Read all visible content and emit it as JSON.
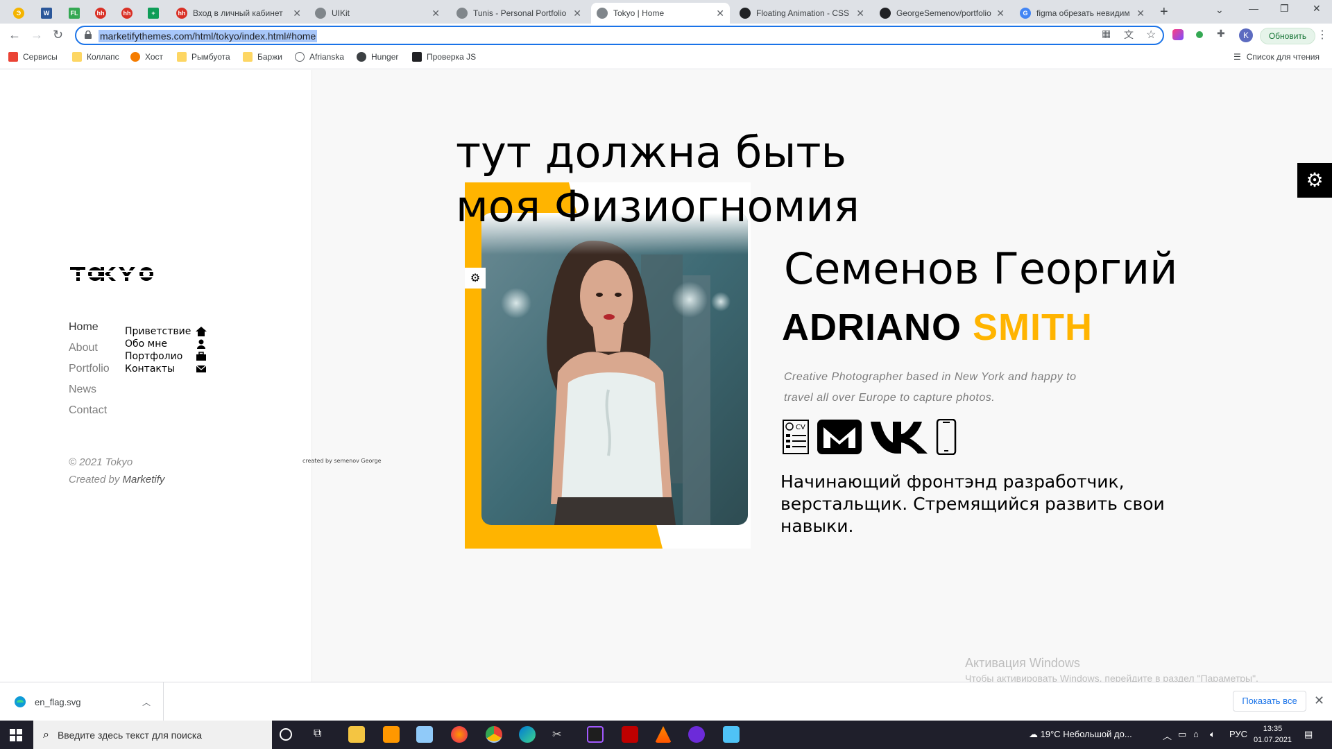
{
  "tabs": [
    {
      "title": "Вход в личный кабинет",
      "fav_color": "#d93025",
      "fav_text": "hh"
    },
    {
      "title": "UIKit",
      "fav_color": "#5f6368",
      "fav_text": ""
    },
    {
      "title": "Tunis - Personal Portfolio",
      "fav_color": "#5f6368",
      "fav_text": ""
    },
    {
      "title": "Tokyo | Home",
      "fav_color": "#5f6368",
      "fav_text": ""
    },
    {
      "title": "Floating Animation - CSS",
      "fav_color": "#202124",
      "fav_text": ""
    },
    {
      "title": "GeorgeSemenov/portfolio",
      "fav_color": "#202124",
      "fav_text": ""
    },
    {
      "title": "figma обрезать невидим",
      "fav_color": "#4285f4",
      "fav_text": "G"
    }
  ],
  "pinned_tabs": [
    {
      "color": "#f4b400",
      "text": "Э"
    },
    {
      "color": "#2b579a",
      "text": "W"
    },
    {
      "color": "#34a853",
      "text": "FL"
    },
    {
      "color": "#d93025",
      "text": "hh"
    },
    {
      "color": "#d93025",
      "text": "hh"
    },
    {
      "color": "#0f9d58",
      "text": "+"
    }
  ],
  "address": {
    "url": "marketifythemes.com/html/tokyo/index.html#home"
  },
  "toolbar": {
    "update_label": "Обновить",
    "profile_initial": "K"
  },
  "bookmarks": [
    {
      "label": "Сервисы",
      "color": "#ea4335"
    },
    {
      "label": "Коллапс",
      "color": "#fdd663"
    },
    {
      "label": "Хост",
      "color": "#f57c00"
    },
    {
      "label": "Рымбуота",
      "color": "#fdd663"
    },
    {
      "label": "Баржи",
      "color": "#fdd663"
    },
    {
      "label": "Afrianska",
      "color": "#5f6368"
    },
    {
      "label": "Hunger",
      "color": "#3c4043"
    },
    {
      "label": "Проверка JS",
      "color": "#202124"
    }
  ],
  "reading_list": "Список для чтения",
  "sidebar": {
    "logo": "TOKYO",
    "nav": [
      "Home",
      "About",
      "Portfolio",
      "News",
      "Contact"
    ],
    "overlay_menu": [
      "Приветствие",
      "Обо мне",
      "Портфолио",
      "Контакты"
    ],
    "copyright": "© 2021 Tokyo",
    "created_by_prefix": "Created by",
    "created_by_name": "Marketify",
    "credit": "created by semenov George"
  },
  "hero": {
    "overlay_title": "тут должна быть моя Физиогномия",
    "name_ru": "Семенов Георгий",
    "name_first": "ADRIANO",
    "name_last": "SMITH",
    "job": "Creative Photographer based in New York and happy to travel all over Europe to capture photos.",
    "bio": "Начинающий фронтэнд разработчик, верстальщик. Стремящийся  развить свои навыки.",
    "accent_color": "#ffb400",
    "socials": [
      "cv-icon",
      "gmail-icon",
      "vk-icon",
      "phone-icon"
    ]
  },
  "activation": {
    "title": "Активация Windows",
    "subtitle": "Чтобы активировать Windows, перейдите в раздел \"Параметры\"."
  },
  "downloads": {
    "file": "en_flag.svg",
    "show_all": "Показать все"
  },
  "taskbar": {
    "search_placeholder": "Введите здесь текст для поиска",
    "weather": "19°C  Небольшой до...",
    "lang": "РУС",
    "time": "13:35",
    "date": "01.07.2021"
  }
}
